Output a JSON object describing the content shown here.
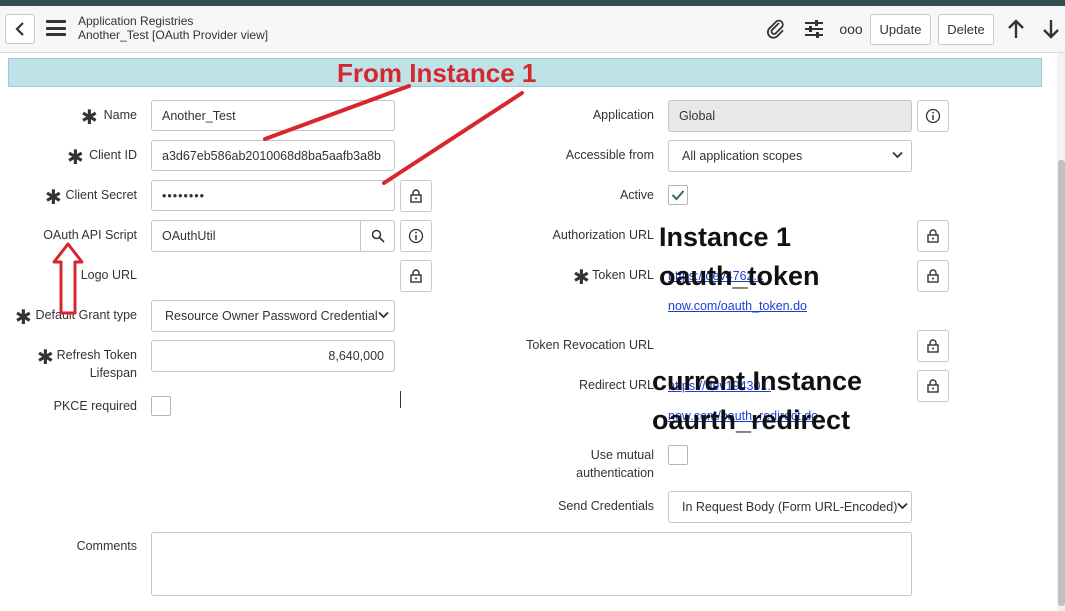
{
  "header": {
    "breadcrumb_title": "Application Registries",
    "breadcrumb_sub": "Another_Test [OAuth Provider view]",
    "update_label": "Update",
    "delete_label": "Delete",
    "more_label": "ooo"
  },
  "form": {
    "name": {
      "label": "Name",
      "value": "Another_Test"
    },
    "client_id": {
      "label": "Client ID",
      "value": "a3d67eb586ab2010068d8ba5aafb3a8b"
    },
    "client_secret": {
      "label": "Client Secret",
      "value": "••••••••"
    },
    "oauth_api_script": {
      "label": "OAuth API Script",
      "value": "OAuthUtil"
    },
    "logo_url": {
      "label": "Logo URL"
    },
    "default_grant_type": {
      "label": "Default Grant type",
      "value": "Resource Owner Password Credential"
    },
    "refresh_token_lifespan": {
      "label_line1": "Refresh Token",
      "label_line2": "Lifespan",
      "value": "8,640,000"
    },
    "pkce_required": {
      "label": "PKCE required",
      "checked": false
    },
    "application": {
      "label": "Application",
      "value": "Global"
    },
    "accessible_from": {
      "label": "Accessible from",
      "value": "All application scopes"
    },
    "active": {
      "label": "Active",
      "checked": true
    },
    "authorization_url": {
      "label": "Authorization URL"
    },
    "token_url": {
      "label": "Token URL",
      "value_line1": "https://dev4762...",
      "value_line2": "now.com/oauth_token.do"
    },
    "token_revocation_url": {
      "label": "Token Revocation URL"
    },
    "redirect_url": {
      "label": "Redirect URL",
      "value_line1": "https://dev19430...",
      "value_line2": "now.com/oauth_redirect.do"
    },
    "use_mutual_auth": {
      "label_line1": "Use mutual",
      "label_line2": "authentication",
      "checked": false
    },
    "send_credentials": {
      "label": "Send Credentials",
      "value": "In Request Body (Form URL-Encoded)"
    },
    "comments": {
      "label": "Comments",
      "value": ""
    }
  },
  "annotations": {
    "from_instance": "From Instance 1",
    "instance1": "Instance 1",
    "oauth_token": "oauth_token",
    "current_instance": "current Instance",
    "oaurth_redirect": "oaurth_redirect"
  },
  "colors": {
    "banner": "#bfe1e8",
    "annotation_red": "#d7262e",
    "link": "#1a3fd1",
    "check": "#2e6e6e"
  }
}
